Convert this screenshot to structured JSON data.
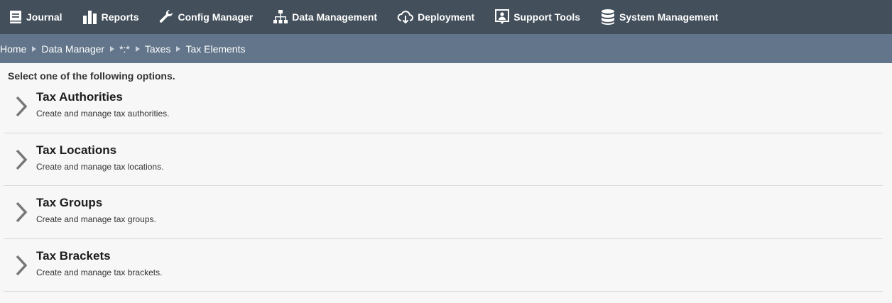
{
  "nav": {
    "items": [
      {
        "label": "Journal",
        "icon": "book-icon"
      },
      {
        "label": "Reports",
        "icon": "bar-chart-icon"
      },
      {
        "label": "Config Manager",
        "icon": "wrench-icon"
      },
      {
        "label": "Data Management",
        "icon": "sitemap-icon"
      },
      {
        "label": "Deployment",
        "icon": "cloud-download-icon"
      },
      {
        "label": "Support Tools",
        "icon": "support-person-icon"
      },
      {
        "label": "System Management",
        "icon": "database-icon"
      }
    ]
  },
  "breadcrumb": {
    "items": [
      "Home",
      "Data Manager",
      "*:*",
      "Taxes",
      "Tax Elements"
    ]
  },
  "instructions": "Select one of the following options.",
  "options": [
    {
      "title": "Tax Authorities",
      "description": "Create and manage tax authorities."
    },
    {
      "title": "Tax Locations",
      "description": "Create and manage tax locations."
    },
    {
      "title": "Tax Groups",
      "description": "Create and manage tax groups."
    },
    {
      "title": "Tax Brackets",
      "description": "Create and manage tax brackets."
    }
  ],
  "colors": {
    "topnav_bg": "#434f5b",
    "breadcrumb_bg": "#62758a",
    "page_bg": "#f7f7f7",
    "chevron": "#777777"
  }
}
